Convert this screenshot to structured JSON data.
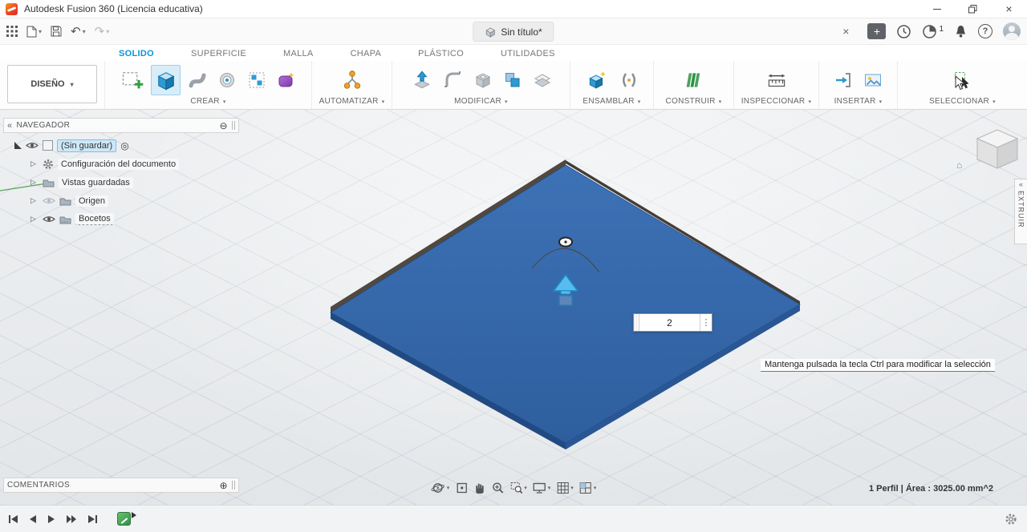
{
  "glyphs": {
    "caret": "▾",
    "collapse": "«",
    "tree_caret": "▷",
    "minus_circle": "⊖",
    "plus_circle": "⊕",
    "close": "×",
    "dots": "⋮",
    "home": "⌂",
    "radio": "◎",
    "question": "?",
    "undo": "↶",
    "redo": "↷",
    "plus": "+"
  },
  "window": {
    "title": "Autodesk Fusion 360 (Licencia educativa)"
  },
  "quickbar": {
    "tab_title": "Sin título*",
    "badge_count": "1"
  },
  "ribbon": {
    "design_label": "DISEÑO",
    "tabs": [
      {
        "label": "SOLIDO"
      },
      {
        "label": "SUPERFICIE"
      },
      {
        "label": "MALLA"
      },
      {
        "label": "CHAPA"
      },
      {
        "label": "PLÁSTICO"
      },
      {
        "label": "UTILIDADES"
      }
    ],
    "groups": {
      "crear": "CREAR",
      "automatizar": "AUTOMATIZAR",
      "modificar": "MODIFICAR",
      "ensamblar": "ENSAMBLAR",
      "construir": "CONSTRUIR",
      "inspeccionar": "INSPECCIONAR",
      "insertar": "INSERTAR",
      "seleccionar": "SELECCIONAR"
    }
  },
  "navigator": {
    "title": "NAVEGADOR",
    "root_label": "(Sin guardar)",
    "items": [
      {
        "label": "Configuración del documento"
      },
      {
        "label": "Vistas guardadas"
      },
      {
        "label": "Origen"
      },
      {
        "label": "Bocetos"
      }
    ]
  },
  "viewport": {
    "hint": "Mantenga pulsada la tecla Ctrl para modificar la selección",
    "extrude_value": "2",
    "side_tab": "EXTRUIR"
  },
  "comments": {
    "title": "COMENTARIOS"
  },
  "status": {
    "selection": "1 Perfil | Área : 3025.00 mm^2"
  }
}
